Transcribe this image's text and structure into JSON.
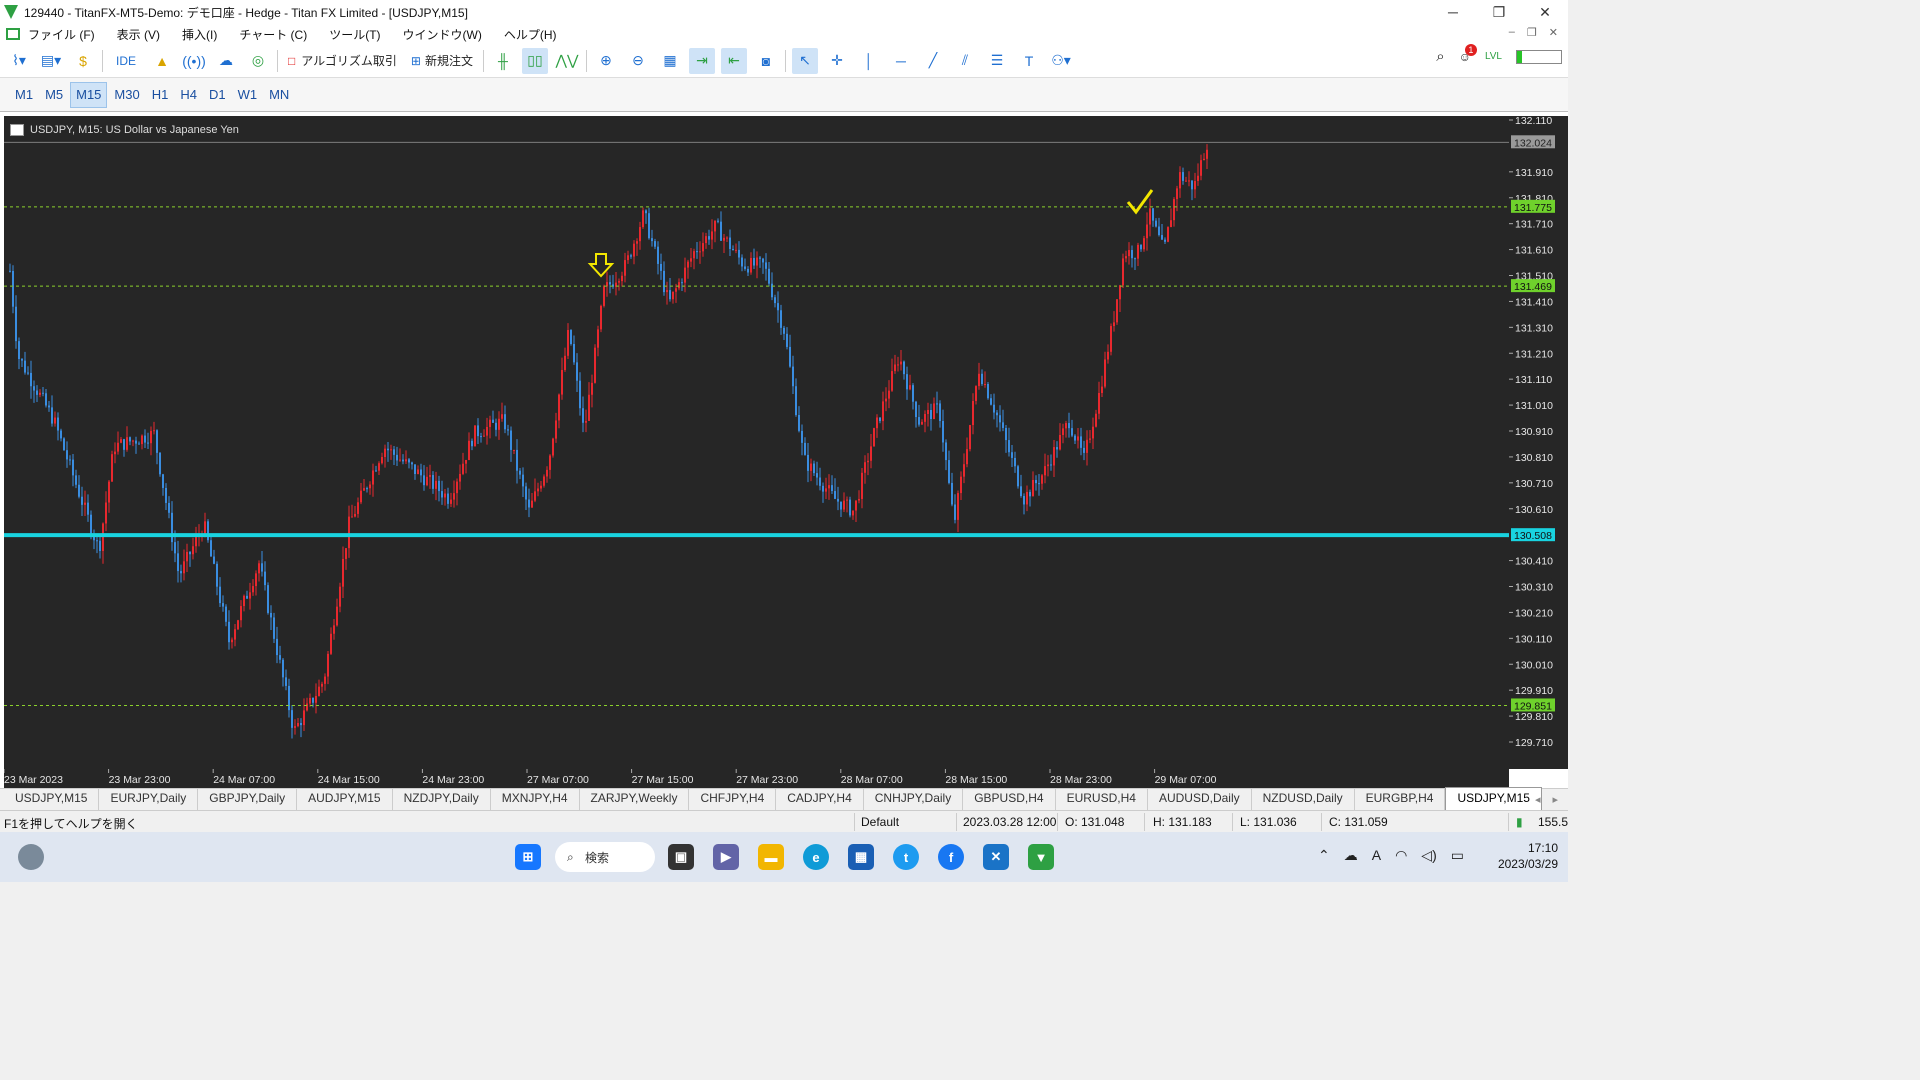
{
  "window": {
    "title": "129440 - TitanFX-MT5-Demo: デモ口座 - Hedge - Titan FX Limited - [USDJPY,M15]",
    "controls": [
      "─",
      "❐",
      "✕"
    ]
  },
  "menu": {
    "items": [
      "ファイル (F)",
      "表示 (V)",
      "挿入(I)",
      "チャート (C)",
      "ツール(T)",
      "ウインドウ(W)",
      "ヘルプ(H)"
    ],
    "mdi_controls": [
      "–",
      "❐",
      "✕"
    ]
  },
  "toolbar": {
    "ide_label": "IDE",
    "algo_label": "アルゴリズム取引",
    "new_order_label": "新規注文",
    "notification_count": "1",
    "connection_level": 0.12
  },
  "timeframes": {
    "items": [
      "M1",
      "M5",
      "M15",
      "M30",
      "H1",
      "H4",
      "D1",
      "W1",
      "MN"
    ],
    "active": "M15"
  },
  "chart": {
    "label": "USDJPY, M15:  US Dollar vs Japanese Yen",
    "background": "#262626",
    "bull_color": "#e8282e",
    "bear_color": "#3a8de0",
    "price_ticks": [
      "132.110",
      "131.910",
      "131.810",
      "131.710",
      "131.610",
      "131.510",
      "131.410",
      "131.310",
      "131.210",
      "131.110",
      "131.010",
      "130.910",
      "130.810",
      "130.710",
      "130.610",
      "130.410",
      "130.310",
      "130.210",
      "130.110",
      "130.010",
      "129.910",
      "129.810",
      "129.710"
    ],
    "time_ticks": [
      "23 Mar 2023",
      "23 Mar 23:00",
      "24 Mar 07:00",
      "24 Mar 15:00",
      "24 Mar 23:00",
      "27 Mar 07:00",
      "27 Mar 15:00",
      "27 Mar 23:00",
      "28 Mar 07:00",
      "28 Mar 15:00",
      "28 Mar 23:00",
      "29 Mar 07:00"
    ],
    "current_price": "132.024",
    "levels": [
      {
        "price": "131.775",
        "style": "dashed",
        "color": "#8bd12c"
      },
      {
        "price": "131.469",
        "style": "dashed",
        "color": "#8bd12c"
      },
      {
        "price": "130.508",
        "style": "solid",
        "color": "#19d3e0"
      },
      {
        "price": "129.851",
        "style": "dashed",
        "color": "#8bd12c"
      }
    ],
    "annotations": [
      {
        "type": "down-arrow",
        "color": "#f2e600"
      },
      {
        "type": "checkmark",
        "color": "#f2e600"
      }
    ]
  },
  "symbol_tabs": {
    "items": [
      "USDJPY,M15",
      "EURJPY,Daily",
      "GBPJPY,Daily",
      "AUDJPY,M15",
      "NZDJPY,Daily",
      "MXNJPY,H4",
      "ZARJPY,Weekly",
      "CHFJPY,H4",
      "CADJPY,H4",
      "CNHJPY,Daily",
      "GBPUSD,H4",
      "EURUSD,H4",
      "AUDUSD,Daily",
      "NZDUSD,Daily",
      "EURGBP,H4",
      "USDJPY,M15"
    ],
    "active_index": 15
  },
  "status": {
    "help": "F1を押してヘルプを開く",
    "profile": "Default",
    "datetime": "2023.03.28 12:00",
    "open": "O: 131.048",
    "high": "H: 131.183",
    "low": "L: 131.036",
    "close": "C: 131.059",
    "ping": "155.5"
  },
  "taskbar": {
    "search_label": "検索",
    "time": "17:10",
    "date": "2023/03/29"
  }
}
